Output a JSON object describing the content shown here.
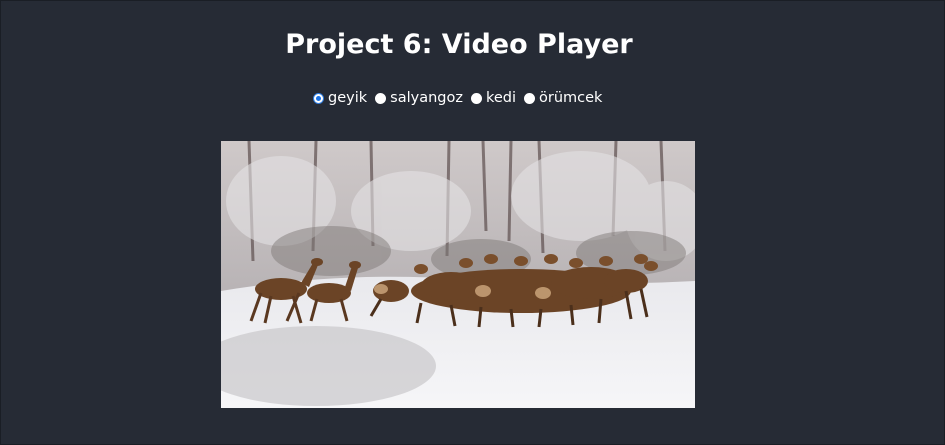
{
  "page": {
    "title": "Project 6: Video Player"
  },
  "animal_options": [
    {
      "label": "geyik",
      "checked": true
    },
    {
      "label": "salyangoz",
      "checked": false
    },
    {
      "label": "kedi",
      "checked": false
    },
    {
      "label": "örümcek",
      "checked": false
    }
  ],
  "video": {
    "scene": "deer herd running across a snowy forest clearing"
  },
  "colors": {
    "background": "#262b35",
    "text": "#ffffff",
    "radio_accent": "#1a73e8"
  }
}
